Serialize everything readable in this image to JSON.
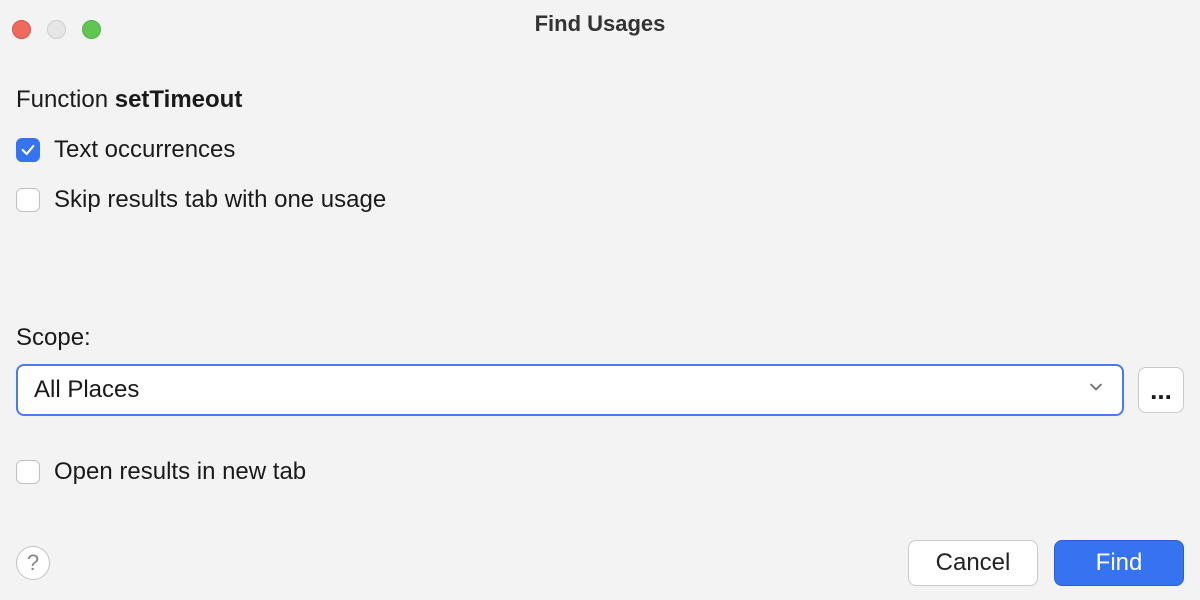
{
  "window": {
    "title": "Find Usages"
  },
  "function": {
    "prefix": "Function",
    "name": "setTimeout"
  },
  "options": {
    "text_occurrences": {
      "label": "Text occurrences",
      "checked": true
    },
    "skip_results_tab": {
      "label": "Skip results tab with one usage",
      "checked": false
    },
    "open_in_new_tab": {
      "label": "Open results in new tab",
      "checked": false
    }
  },
  "scope": {
    "label": "Scope:",
    "value": "All Places",
    "more": "..."
  },
  "buttons": {
    "help": "?",
    "cancel": "Cancel",
    "find": "Find"
  }
}
